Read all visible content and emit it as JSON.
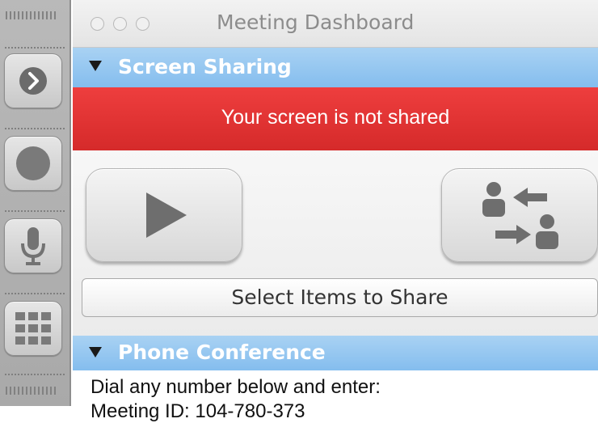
{
  "window": {
    "title": "Meeting Dashboard"
  },
  "toolbar": {
    "items": [
      {
        "icon": "chevron-right-icon"
      },
      {
        "icon": "record-icon"
      },
      {
        "icon": "microphone-icon"
      },
      {
        "icon": "grid-icon"
      }
    ]
  },
  "screen_sharing": {
    "header": "Screen Sharing",
    "status": "Your screen is not shared",
    "play_icon": "play-icon",
    "swap_presenter_icon": "swap-presenter-icon",
    "select_button": "Select Items to Share"
  },
  "phone_conference": {
    "header": "Phone Conference",
    "instructions": "Dial any number below and enter:",
    "meeting_id": "Meeting ID: 104-780-373"
  },
  "colors": {
    "section_header": "#93c6f0",
    "status_banner": "#e23434",
    "toolbar": "#b1b1b1"
  }
}
